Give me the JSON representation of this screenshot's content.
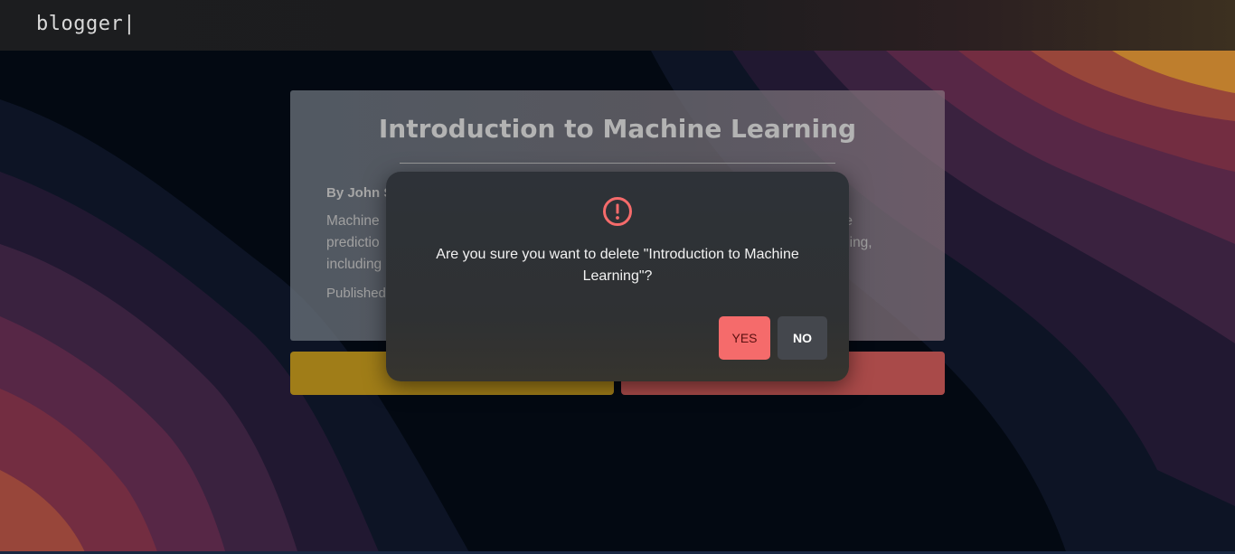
{
  "colors": {
    "warning": "#f56b6b",
    "edit_button": "#a9841a",
    "delete_button": "#b34f4d",
    "navbar": "#1c1d1f",
    "modal": "#2f3238"
  },
  "navbar": {
    "brand": "blogger|"
  },
  "post": {
    "title": "Introduction to Machine Learning",
    "author": "By John S",
    "body_line_1": "Machine",
    "body_line_1_end": "ake",
    "body_line_2": "predictio",
    "body_line_2_end": "ning,",
    "body_line_3": "including",
    "published": "Published"
  },
  "modal": {
    "icon": "exclamation-circle-icon",
    "message": "Are you sure you want to delete \"Introduction to Machine Learning\"?",
    "yes_label": "YES",
    "no_label": "NO"
  }
}
